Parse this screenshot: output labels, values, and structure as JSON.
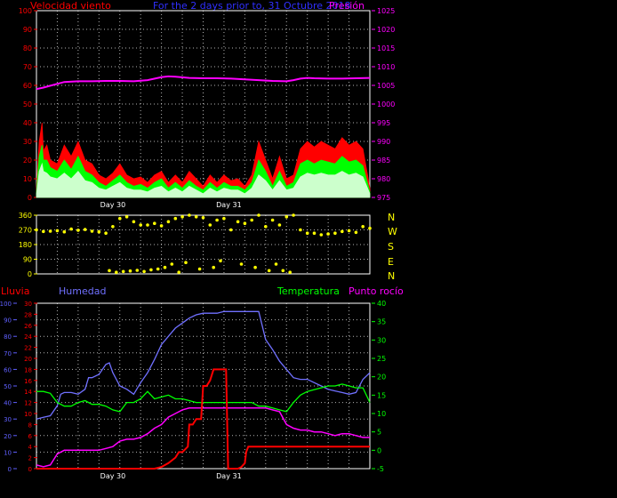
{
  "header": {
    "wind_label": "Velocidad viento",
    "title": "For the 2 days prior to, 31 Octubre 2018",
    "pressure_label": "Presión"
  },
  "direction_panel": {
    "compass_letters": [
      "N",
      "W",
      "S",
      "E",
      "N"
    ]
  },
  "lower_header": {
    "rain_label": "Lluvia",
    "humidity_label": "Humedad",
    "temperature_label": "Temperatura",
    "dewpoint_label": "Punto rocío"
  },
  "colors": {
    "wind_gust": "#ff0000",
    "wind_mid": "#00ff00",
    "wind_avg": "#ccffcc",
    "pressure": "#ff00ff",
    "direction": "#ffff00",
    "rain": "#ff0000",
    "humidity": "#7070ff",
    "temperature": "#00ff00",
    "dewpoint": "#ff00ff",
    "grid": "#ffffff",
    "axis_red": "#ff0000",
    "axis_magenta": "#ff00ff",
    "axis_yellow": "#ffff00",
    "axis_blue": "#6060ff",
    "axis_green": "#00ff00"
  },
  "chart_data": [
    {
      "type": "line",
      "x_unit": "hours",
      "x_range": [
        0,
        48
      ],
      "xticks": [
        {
          "label": "Day 30",
          "x": 11
        },
        {
          "label": "Day 31",
          "x": 27.7
        }
      ],
      "axes": {
        "wind": {
          "range": [
            0,
            100
          ],
          "ticks": [
            0,
            10,
            20,
            30,
            40,
            50,
            60,
            70,
            80,
            90,
            100
          ]
        },
        "pressure": {
          "range": [
            975,
            1025
          ],
          "ticks": [
            975,
            980,
            985,
            990,
            995,
            1000,
            1005,
            1010,
            1015,
            1020,
            1025
          ]
        }
      },
      "series": [
        {
          "key": "gust",
          "axis": "wind",
          "x": [
            0,
            0.4,
            0.8,
            1,
            1.5,
            2,
            3,
            4,
            5,
            6,
            7,
            8,
            9,
            10,
            11,
            12,
            13,
            14,
            15,
            16,
            17,
            18,
            19,
            20,
            21,
            22,
            23,
            24,
            25,
            26,
            27,
            28,
            29,
            30,
            31,
            32,
            33,
            34,
            35,
            36,
            37,
            38,
            39,
            40,
            41,
            42,
            43,
            44,
            45,
            46,
            47,
            48
          ],
          "values": [
            5,
            30,
            40,
            25,
            28,
            20,
            18,
            28,
            22,
            30,
            20,
            18,
            12,
            10,
            13,
            18,
            12,
            10,
            11,
            8,
            12,
            14,
            8,
            12,
            8,
            14,
            10,
            6,
            12,
            8,
            12,
            9,
            10,
            6,
            12,
            30,
            20,
            10,
            22,
            10,
            12,
            26,
            30,
            27,
            30,
            28,
            26,
            32,
            28,
            30,
            26,
            5
          ]
        },
        {
          "key": "mid",
          "axis": "wind",
          "x": [
            0,
            0.4,
            0.8,
            1,
            1.5,
            2,
            3,
            4,
            5,
            6,
            7,
            8,
            9,
            10,
            11,
            12,
            13,
            14,
            15,
            16,
            17,
            18,
            19,
            20,
            21,
            22,
            23,
            24,
            25,
            26,
            27,
            28,
            29,
            30,
            31,
            32,
            33,
            34,
            35,
            36,
            37,
            38,
            39,
            40,
            41,
            42,
            43,
            44,
            45,
            46,
            47,
            48
          ],
          "values": [
            3,
            22,
            28,
            20,
            20,
            16,
            14,
            20,
            15,
            22,
            14,
            12,
            8,
            6,
            9,
            12,
            8,
            6,
            7,
            5,
            8,
            10,
            5,
            8,
            5,
            9,
            6,
            4,
            8,
            5,
            8,
            6,
            6,
            4,
            8,
            20,
            14,
            6,
            14,
            6,
            8,
            18,
            20,
            18,
            20,
            19,
            18,
            22,
            19,
            20,
            17,
            3
          ]
        },
        {
          "key": "avg",
          "axis": "wind",
          "x": [
            0,
            0.4,
            0.8,
            1,
            1.5,
            2,
            3,
            4,
            5,
            6,
            7,
            8,
            9,
            10,
            11,
            12,
            13,
            14,
            15,
            16,
            17,
            18,
            19,
            20,
            21,
            22,
            23,
            24,
            25,
            26,
            27,
            28,
            29,
            30,
            31,
            32,
            33,
            34,
            35,
            36,
            37,
            38,
            39,
            40,
            41,
            42,
            43,
            44,
            45,
            46,
            47,
            48
          ],
          "values": [
            2,
            14,
            18,
            14,
            13,
            11,
            10,
            13,
            10,
            14,
            9,
            8,
            5,
            4,
            6,
            8,
            5,
            4,
            4,
            3,
            5,
            6,
            3,
            5,
            3,
            6,
            4,
            2,
            5,
            3,
            5,
            4,
            4,
            2,
            5,
            12,
            9,
            4,
            9,
            4,
            5,
            11,
            13,
            12,
            13,
            12,
            12,
            14,
            12,
            13,
            11,
            2
          ]
        },
        {
          "key": "pressure",
          "axis": "pressure",
          "x": [
            0,
            1,
            2,
            3,
            4,
            6,
            8,
            10,
            12,
            14,
            16,
            18,
            19,
            20,
            22,
            24,
            26,
            28,
            30,
            32,
            34,
            36,
            37,
            38,
            39,
            40,
            42,
            44,
            46,
            48
          ],
          "values": [
            1004,
            1004.4,
            1004.9,
            1005.4,
            1005.9,
            1006.1,
            1006.1,
            1006.2,
            1006.2,
            1006.1,
            1006.4,
            1007.2,
            1007.4,
            1007.3,
            1007.0,
            1006.9,
            1006.9,
            1006.8,
            1006.6,
            1006.4,
            1006.2,
            1006.1,
            1006.4,
            1006.8,
            1007.0,
            1006.9,
            1006.8,
            1006.8,
            1006.9,
            1007.0
          ]
        }
      ]
    },
    {
      "type": "scatter",
      "x_unit": "hours",
      "x_range": [
        0,
        48
      ],
      "y_range": [
        0,
        360
      ],
      "yticks": [
        0,
        90,
        180,
        270,
        360
      ],
      "series": [
        {
          "key": "direction",
          "x": [
            0,
            1,
            2,
            3,
            4,
            5,
            6,
            7,
            8,
            9,
            10,
            11,
            12,
            13,
            14,
            15,
            16,
            17,
            18,
            19,
            20,
            21,
            22,
            23,
            24,
            25,
            26,
            27,
            28,
            29,
            30,
            31,
            32,
            33,
            34,
            35,
            36,
            37,
            38,
            39,
            40,
            41,
            42,
            43,
            44,
            45,
            46,
            47,
            48,
            10.5,
            11.5,
            12.5,
            13.5,
            14.5,
            15.5,
            16.5,
            17.5,
            18.5,
            19.5,
            20.5,
            21.5,
            23.5,
            25.5,
            26.5,
            29.5,
            31.5,
            33.5,
            34.5,
            35.5,
            36.5
          ],
          "values": [
            270,
            260,
            262,
            265,
            258,
            275,
            268,
            272,
            262,
            258,
            250,
            290,
            340,
            350,
            320,
            300,
            300,
            310,
            295,
            320,
            340,
            350,
            360,
            350,
            345,
            300,
            330,
            340,
            270,
            320,
            310,
            330,
            360,
            290,
            330,
            300,
            350,
            360,
            270,
            250,
            250,
            240,
            245,
            250,
            260,
            265,
            255,
            290,
            280,
            20,
            10,
            15,
            18,
            22,
            15,
            25,
            30,
            40,
            60,
            10,
            70,
            30,
            40,
            80,
            60,
            40,
            20,
            60,
            20,
            10
          ]
        }
      ]
    },
    {
      "type": "line",
      "x_unit": "hours",
      "x_range": [
        0,
        48
      ],
      "xticks": [
        {
          "label": "Day 30",
          "x": 11
        },
        {
          "label": "Day 31",
          "x": 27.7
        }
      ],
      "axes": {
        "rain": {
          "range": [
            0,
            30
          ],
          "ticks": [
            0,
            2,
            4,
            6,
            8,
            10,
            12,
            14,
            16,
            18,
            20,
            22,
            24,
            26,
            28,
            30
          ]
        },
        "humidity": {
          "range": [
            0,
            100
          ],
          "ticks": [
            0,
            10,
            20,
            30,
            40,
            50,
            60,
            70,
            80,
            90,
            100
          ]
        },
        "temperature": {
          "range": [
            -5,
            40
          ],
          "ticks": [
            -5,
            0,
            5,
            10,
            15,
            20,
            25,
            30,
            35,
            40
          ]
        }
      },
      "series": [
        {
          "key": "humidity",
          "axis": "humidity",
          "x": [
            0,
            1,
            2,
            3,
            3.5,
            4,
            5,
            6,
            7,
            7.5,
            8,
            9,
            10,
            10.5,
            11,
            12,
            13,
            14,
            15,
            16,
            17,
            18,
            19,
            20,
            21,
            22,
            23,
            24,
            25,
            26,
            27,
            28,
            29,
            30,
            31,
            32,
            33,
            34,
            35,
            36,
            37,
            38,
            39,
            40,
            41,
            42,
            43,
            44,
            45,
            46,
            47,
            48
          ],
          "values": [
            30,
            31,
            32,
            38,
            45,
            46,
            46,
            45,
            48,
            55,
            55,
            57,
            63,
            64,
            58,
            50,
            48,
            45,
            52,
            58,
            66,
            75,
            80,
            85,
            88,
            91,
            93,
            94,
            94,
            94,
            95,
            95,
            95,
            95,
            95,
            95,
            78,
            72,
            65,
            60,
            55,
            54,
            54,
            52,
            50,
            48,
            47,
            46,
            45,
            46,
            54,
            58
          ]
        },
        {
          "key": "temperature",
          "axis": "temperature",
          "x": [
            0,
            1,
            2,
            3,
            4,
            5,
            6,
            7,
            8,
            9,
            10,
            11,
            12,
            13,
            14,
            15,
            16,
            17,
            18,
            19,
            20,
            21,
            22,
            23,
            24,
            25,
            26,
            27,
            28,
            29,
            30,
            31,
            32,
            33,
            34,
            35,
            36,
            37,
            38,
            39,
            40,
            41,
            42,
            43,
            44,
            45,
            46,
            47,
            48
          ],
          "values": [
            16,
            16,
            15.5,
            13,
            12,
            12,
            13,
            13.5,
            12.5,
            12.5,
            12,
            11,
            10.5,
            13,
            13,
            14,
            16,
            14,
            14.5,
            15,
            14,
            14,
            13.5,
            13,
            13,
            13,
            13,
            13,
            13,
            13,
            13,
            13,
            12,
            12,
            11.5,
            11,
            10.5,
            13,
            15,
            16,
            16.5,
            17,
            17.5,
            17.5,
            18,
            17.5,
            17,
            17,
            13
          ]
        },
        {
          "key": "dewpoint",
          "axis": "temperature",
          "x": [
            0,
            1,
            2,
            3,
            4,
            5,
            6,
            7,
            8,
            9,
            10,
            11,
            12,
            13,
            14,
            15,
            16,
            17,
            18,
            19,
            20,
            21,
            22,
            23,
            24,
            25,
            26,
            27,
            28,
            29,
            30,
            31,
            32,
            33,
            34,
            35,
            36,
            37,
            38,
            39,
            40,
            41,
            42,
            43,
            44,
            45,
            46,
            47,
            48
          ],
          "values": [
            -4,
            -4.5,
            -4,
            -1,
            0,
            0,
            0,
            0,
            0,
            0,
            0.5,
            1,
            2.5,
            3,
            3,
            3.5,
            4.5,
            6,
            7,
            9,
            10,
            11,
            11.5,
            11.5,
            11.5,
            11.5,
            11.5,
            11.5,
            11.5,
            11.5,
            11.5,
            11.5,
            11.5,
            11.5,
            11,
            10.5,
            7,
            6,
            5.5,
            5.5,
            5,
            5,
            4.5,
            4,
            4.5,
            4.5,
            4,
            3.5,
            3.5
          ]
        },
        {
          "key": "rain",
          "axis": "rain",
          "x": [
            0,
            1,
            2,
            3,
            4,
            5,
            6,
            7,
            8,
            9,
            10,
            11,
            12,
            13,
            14,
            15,
            16,
            17,
            18,
            19,
            20,
            20.5,
            21,
            21.8,
            22,
            22.5,
            23,
            23.4,
            23.7,
            24,
            24.5,
            25,
            25.5,
            26,
            26.5,
            27,
            27.3,
            27.6,
            27.8,
            28,
            28.2,
            29,
            29.5,
            30,
            30.2,
            30.5,
            31,
            32,
            33,
            34,
            35,
            36,
            37,
            38,
            39,
            40,
            41,
            42,
            43,
            44,
            45,
            46,
            47,
            48
          ],
          "values": [
            0,
            0,
            0,
            0,
            0,
            0,
            0,
            0,
            0,
            0,
            0,
            0,
            0,
            0,
            0,
            0,
            0,
            0,
            0.3,
            1,
            2,
            3,
            3,
            4,
            8,
            8,
            9,
            9,
            9,
            15,
            15,
            16,
            18,
            18,
            18,
            18,
            18,
            0,
            0,
            0,
            0,
            0,
            0.3,
            1,
            3,
            4,
            4,
            4,
            4,
            4,
            4,
            4,
            4,
            4,
            4,
            4,
            4,
            4,
            4,
            4,
            4,
            4,
            4,
            4
          ]
        }
      ]
    }
  ]
}
